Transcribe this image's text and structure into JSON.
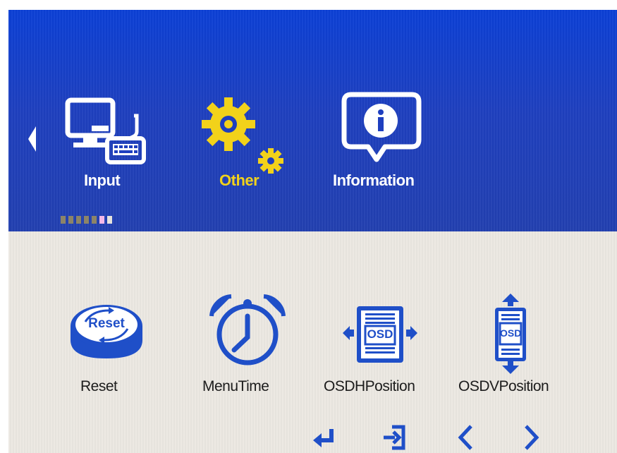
{
  "top_menu": {
    "items": [
      {
        "label": "Input",
        "icon": "monitor-keyboard-icon",
        "color": "#ffffff"
      },
      {
        "label": "Other",
        "icon": "gears-icon",
        "color": "#f2d21a",
        "selected": true
      },
      {
        "label": "Information",
        "icon": "info-bubble-icon",
        "color": "#ffffff"
      }
    ],
    "left_arrow_icon": "caret-left-icon"
  },
  "pager": {
    "total": 7,
    "active_index": 5
  },
  "sub_menu": {
    "items": [
      {
        "label": "Reset",
        "icon": "reset-icon",
        "icon_text": "Reset"
      },
      {
        "label": "MenuTime",
        "icon": "alarm-clock-icon"
      },
      {
        "label": "OSDHPosition",
        "icon": "osd-h-position-icon",
        "icon_text": "OSD"
      },
      {
        "label": "OSDVPosition",
        "icon": "osd-v-position-icon",
        "icon_text": "OSD"
      }
    ]
  },
  "nav_bar": {
    "icons": [
      "enter-icon",
      "exit-icon",
      "left-chevron-icon",
      "right-chevron-icon"
    ]
  },
  "colors": {
    "accent_blue": "#1f4fc8",
    "highlight_yellow": "#f2d21a",
    "panel_blue": "#1e3fbf",
    "panel_light": "#ece8e2"
  }
}
